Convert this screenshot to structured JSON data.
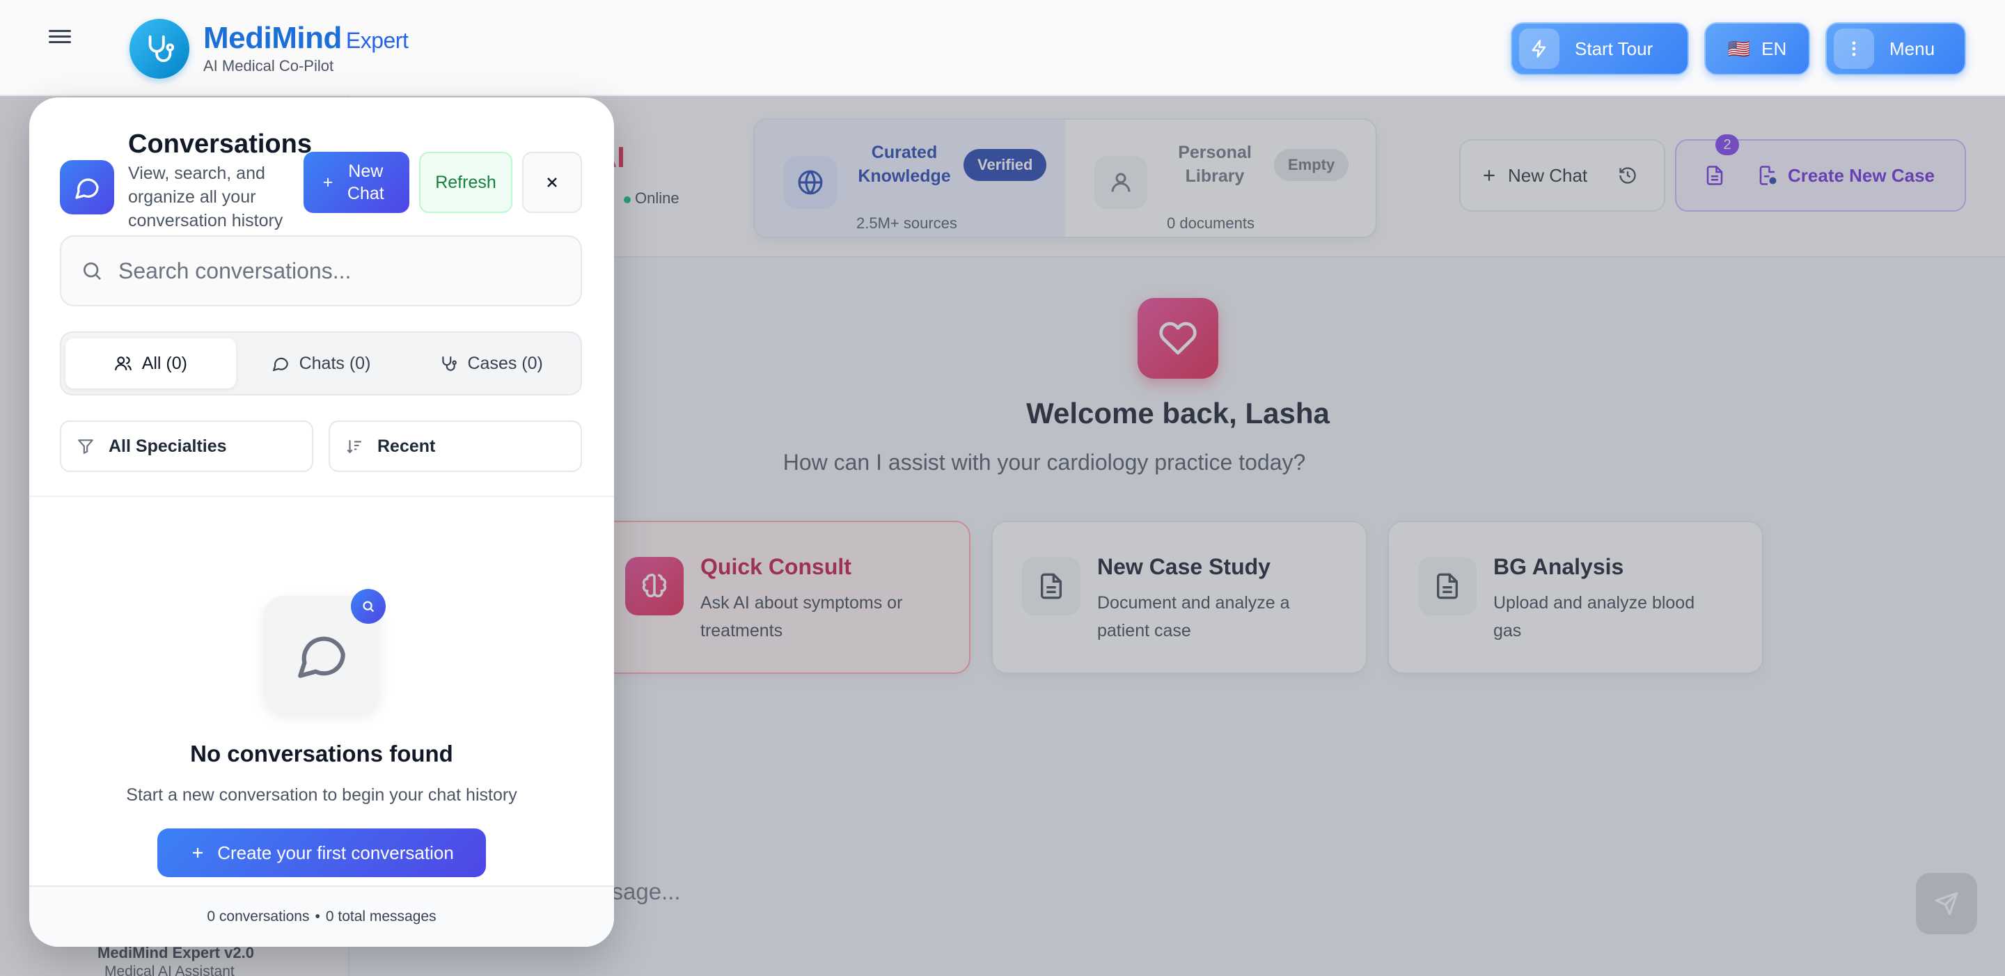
{
  "header": {
    "brand_name": "MediMind",
    "brand_suffix": "Expert",
    "brand_subtitle": "AI Medical Co-Pilot",
    "tour_label": "Start Tour",
    "lang_flag": "🇺🇸",
    "lang_label": "EN",
    "menu_label": "Menu"
  },
  "chat_header": {
    "title_fragment": "d AI",
    "status": "Online",
    "knowledge": [
      {
        "name": "Curated Knowledge",
        "meta": "2.5M+ sources",
        "badge": "Verified"
      },
      {
        "name": "Personal Library",
        "meta": "0 documents",
        "badge": "Empty"
      }
    ],
    "new_chat_label": "New Chat",
    "case_count": "2",
    "create_case_label": "Create New Case"
  },
  "welcome": {
    "title": "Welcome back, Lasha",
    "subtitle": "How can I assist with your cardiology practice today?"
  },
  "cards": [
    {
      "title": "Quick Consult",
      "desc": "Ask AI about symptoms or treatments"
    },
    {
      "title": "New Case Study",
      "desc": "Document and analyze a patient case"
    },
    {
      "title": "BG Analysis",
      "desc": "Upload and analyze blood gas"
    }
  ],
  "composer": {
    "placeholder_fragment": "ssage..."
  },
  "sidebar": {
    "footer_title": "MediMind Expert v2.0",
    "footer_subtitle": "Medical AI Assistant"
  },
  "modal": {
    "title": "Conversations",
    "description": "View, search, and organize all your conversation history",
    "new_chat_label": "New Chat",
    "refresh_label": "Refresh",
    "search_placeholder": "Search conversations...",
    "tabs": [
      {
        "label": "All (0)"
      },
      {
        "label": "Chats (0)"
      },
      {
        "label": "Cases (0)"
      }
    ],
    "filter_specialty": "All Specialties",
    "filter_sort": "Recent",
    "empty_title": "No conversations found",
    "empty_subtitle": "Start a new conversation to begin your chat history",
    "create_first_label": "Create your first conversation",
    "footer_conversations": "0 conversations",
    "footer_separator": "•",
    "footer_messages": "0 total messages"
  },
  "colors": {
    "primary": "#3b82f6",
    "accent_rose": "#e11d48",
    "success": "#15803d",
    "purple": "#6d28d9"
  }
}
